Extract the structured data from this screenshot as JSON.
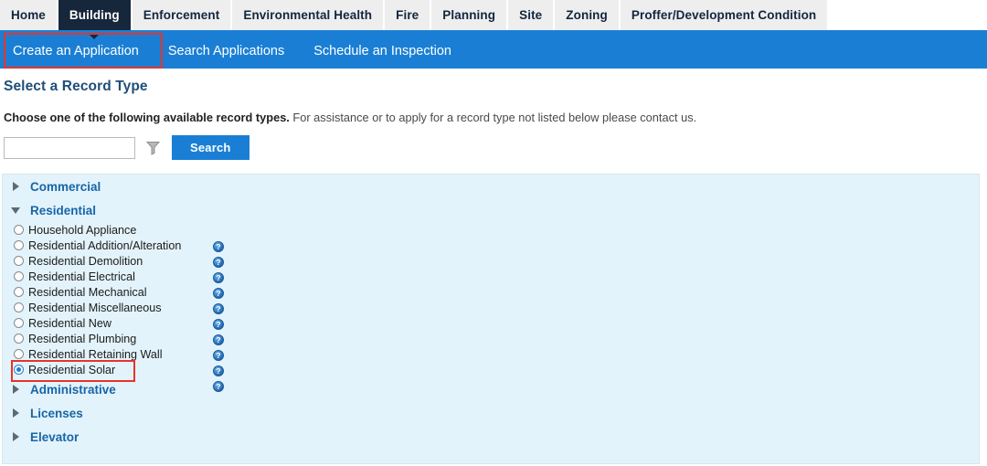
{
  "colors": {
    "accent_blue": "#1a7fd4",
    "tab_active_bg": "#16273c",
    "tab_bg": "#eeeeee",
    "panel_bg": "#e3f3fb",
    "highlight_red": "#e8332a",
    "heading_blue": "#1f4e79",
    "group_link_blue": "#1765a8"
  },
  "tabs": [
    {
      "label": "Home",
      "active": false
    },
    {
      "label": "Building",
      "active": true
    },
    {
      "label": "Enforcement",
      "active": false
    },
    {
      "label": "Environmental Health",
      "active": false
    },
    {
      "label": "Fire",
      "active": false
    },
    {
      "label": "Planning",
      "active": false
    },
    {
      "label": "Site",
      "active": false
    },
    {
      "label": "Zoning",
      "active": false
    },
    {
      "label": "Proffer/Development Condition",
      "active": false
    }
  ],
  "subnav": {
    "items": [
      {
        "label": "Create an Application",
        "selected": true
      },
      {
        "label": "Search Applications",
        "selected": false
      },
      {
        "label": "Schedule an Inspection",
        "selected": false
      }
    ]
  },
  "page": {
    "title": "Select a Record Type",
    "instructions_bold": "Choose one of the following available record types.",
    "instructions_rest": " For assistance or to apply for a record type not listed below please contact us."
  },
  "search": {
    "value": "",
    "placeholder": "",
    "filter_icon": "funnel-filter-icon",
    "button_label": "Search"
  },
  "tree": {
    "groups": [
      {
        "label": "Commercial",
        "expanded": false,
        "items": []
      },
      {
        "label": "Residential",
        "expanded": true,
        "items": [
          {
            "label": "Household Appliance",
            "selected": false,
            "help": "?"
          },
          {
            "label": "Residential Addition/Alteration",
            "selected": false,
            "help": "?"
          },
          {
            "label": "Residential Demolition",
            "selected": false,
            "help": "?"
          },
          {
            "label": "Residential Electrical",
            "selected": false,
            "help": "?"
          },
          {
            "label": "Residential Mechanical",
            "selected": false,
            "help": "?"
          },
          {
            "label": "Residential Miscellaneous",
            "selected": false,
            "help": "?"
          },
          {
            "label": "Residential New",
            "selected": false,
            "help": "?"
          },
          {
            "label": "Residential Plumbing",
            "selected": false,
            "help": "?"
          },
          {
            "label": "Residential Retaining Wall",
            "selected": false,
            "help": "?"
          },
          {
            "label": "Residential Solar",
            "selected": true,
            "help": "?"
          }
        ]
      },
      {
        "label": "Administrative",
        "expanded": false,
        "items": []
      },
      {
        "label": "Licenses",
        "expanded": false,
        "items": []
      },
      {
        "label": "Elevator",
        "expanded": false,
        "items": []
      }
    ]
  },
  "annotations": [
    {
      "name": "highlight-create-an-application",
      "color": "#e8332a"
    },
    {
      "name": "highlight-residential-solar",
      "color": "#e8332a"
    }
  ]
}
